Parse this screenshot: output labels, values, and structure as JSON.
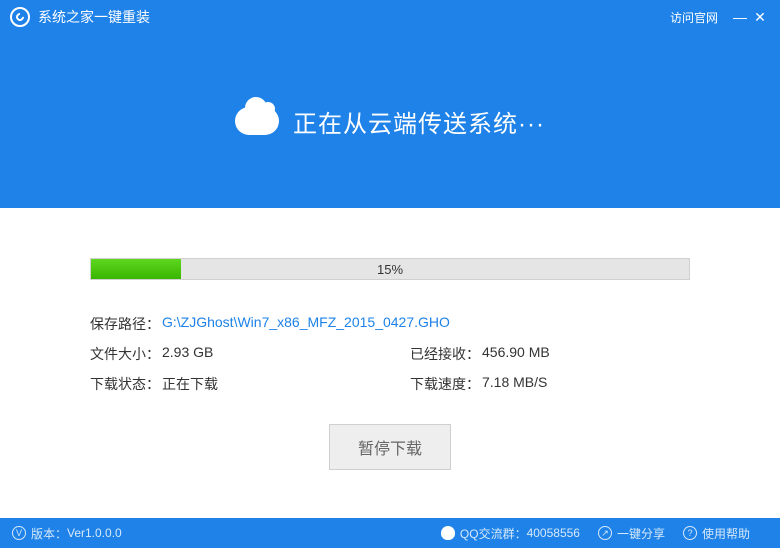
{
  "titlebar": {
    "app_title": "系统之家一键重装",
    "visit_official": "访问官网"
  },
  "hero": {
    "status_text": "正在从云端传送系统···"
  },
  "progress": {
    "percent": 15,
    "percent_text": "15%"
  },
  "info": {
    "save_path_label": "保存路径：",
    "save_path_value": "G:\\ZJGhost\\Win7_x86_MFZ_2015_0427.GHO",
    "file_size_label": "文件大小：",
    "file_size_value": "2.93 GB",
    "received_label": "已经接收：",
    "received_value": "456.90 MB",
    "status_label": "下载状态：",
    "status_value": "正在下载",
    "speed_label": "下载速度：",
    "speed_value": "7.18 MB/S"
  },
  "actions": {
    "pause_label": "暂停下载"
  },
  "footer": {
    "version_label": "版本：",
    "version_value": "Ver1.0.0.0",
    "qq_label": "QQ交流群：",
    "qq_value": "40058556",
    "share_label": "一键分享",
    "help_label": "使用帮助"
  }
}
